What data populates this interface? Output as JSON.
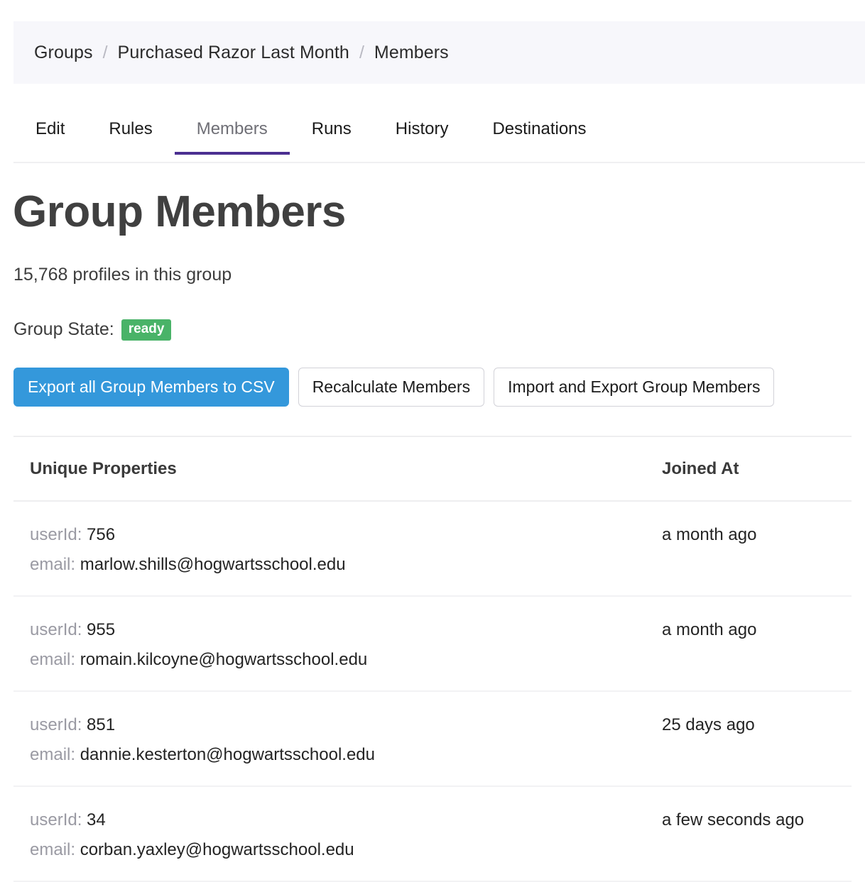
{
  "breadcrumb": {
    "separator": "/",
    "items": [
      {
        "label": "Groups"
      },
      {
        "label": "Purchased Razor Last Month"
      },
      {
        "label": "Members"
      }
    ]
  },
  "tabs": [
    {
      "label": "Edit",
      "active": false
    },
    {
      "label": "Rules",
      "active": false
    },
    {
      "label": "Members",
      "active": true
    },
    {
      "label": "Runs",
      "active": false
    },
    {
      "label": "History",
      "active": false
    },
    {
      "label": "Destinations",
      "active": false
    }
  ],
  "header": {
    "title": "Group Members",
    "subtitle": "15,768 profiles in this group",
    "profile_count": "15,768"
  },
  "group_state": {
    "label": "Group State:",
    "value": "ready",
    "badge_color": "#49b368"
  },
  "actions": {
    "export_csv_label": "Export all Group Members to CSV",
    "recalculate_label": "Recalculate Members",
    "import_export_label": "Import and Export Group Members",
    "primary_color": "#3498db"
  },
  "table": {
    "columns": {
      "properties": "Unique Properties",
      "joined_at": "Joined At"
    },
    "rows": [
      {
        "userid_key": "userId:",
        "userid_value": "756",
        "email_key": "email:",
        "email_value": "marlow.shills@hogwartsschool.edu",
        "joined_at": "a month ago"
      },
      {
        "userid_key": "userId:",
        "userid_value": "955",
        "email_key": "email:",
        "email_value": "romain.kilcoyne@hogwartsschool.edu",
        "joined_at": "a month ago"
      },
      {
        "userid_key": "userId:",
        "userid_value": "851",
        "email_key": "email:",
        "email_value": "dannie.kesterton@hogwartsschool.edu",
        "joined_at": "25 days ago"
      },
      {
        "userid_key": "userId:",
        "userid_value": "34",
        "email_key": "email:",
        "email_value": "corban.yaxley@hogwartsschool.edu",
        "joined_at": "a few seconds ago"
      }
    ]
  }
}
